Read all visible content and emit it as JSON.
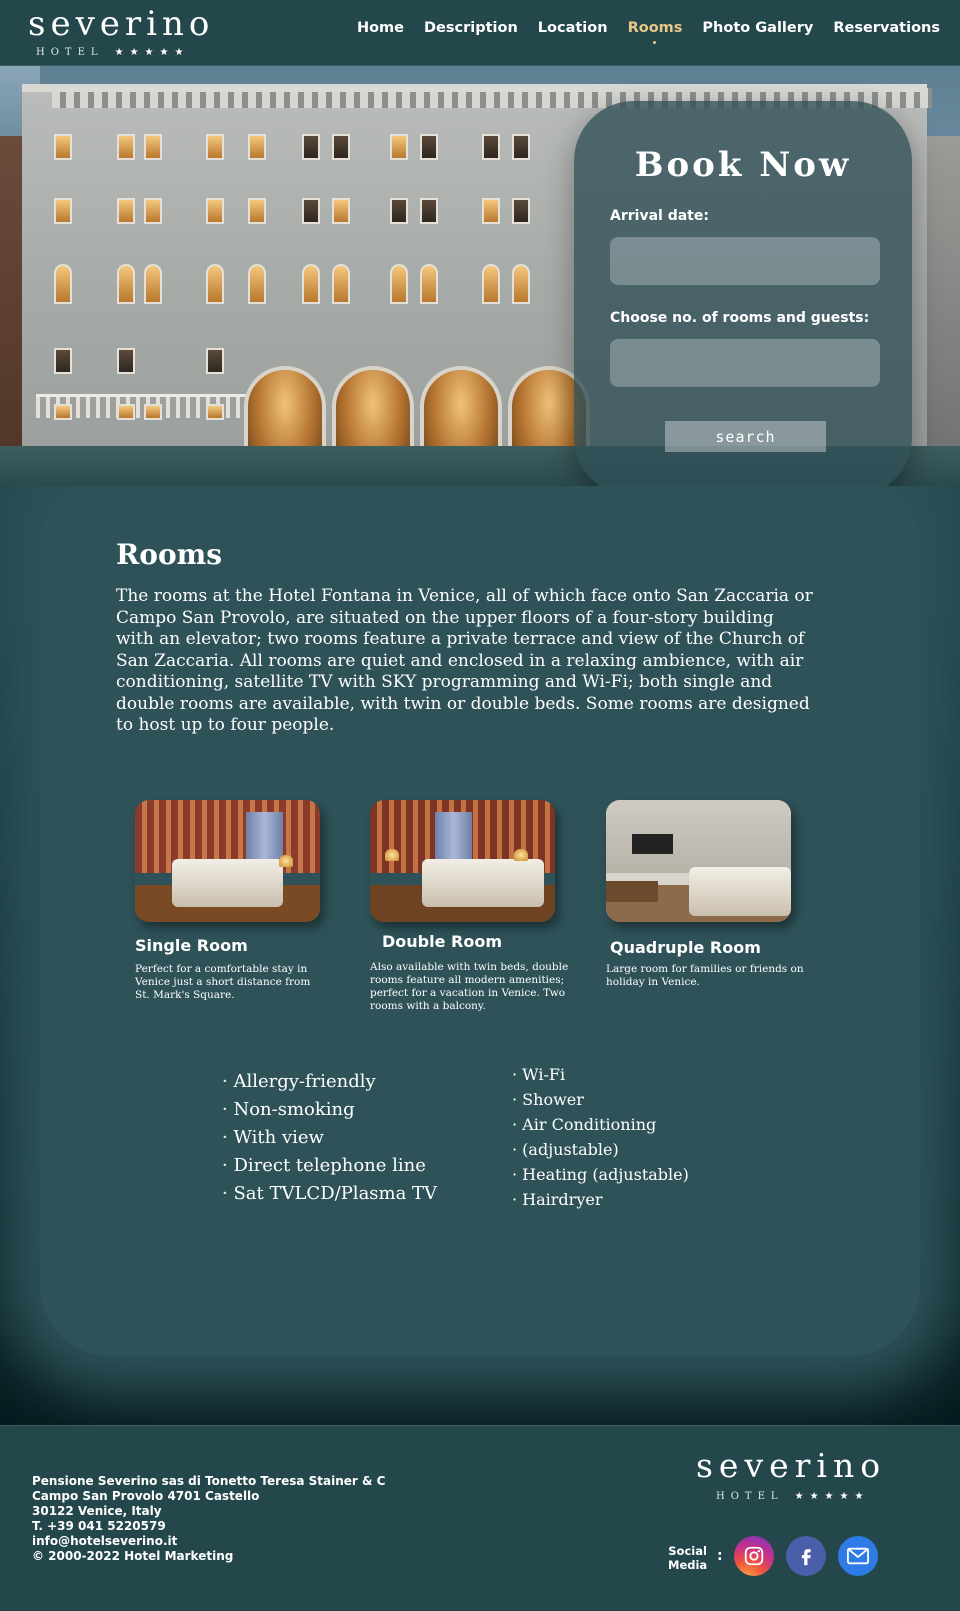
{
  "brand": {
    "name": "severino",
    "sub": "HOTEL",
    "stars": "★★★★★"
  },
  "nav": {
    "items": [
      {
        "label": "Home"
      },
      {
        "label": "Description"
      },
      {
        "label": "Location"
      },
      {
        "label": "Rooms",
        "active": true
      },
      {
        "label": "Photo Gallery"
      },
      {
        "label": "Reservations"
      }
    ]
  },
  "booking": {
    "title": "Book Now",
    "arrival_label": "Arrival date:",
    "arrival_value": "",
    "guests_label": "Choose no. of rooms and guests:",
    "guests_value": "",
    "search_label": "search"
  },
  "rooms": {
    "title": "Rooms",
    "intro": "The rooms at the Hotel Fontana in Venice, all of which face onto San Zaccaria or Campo San Provolo, are situated on the upper floors of a four-story building with an elevator; two rooms feature a private terrace and view of the Church of San Zaccaria. All rooms are quiet and enclosed in a relaxing ambience, with air conditioning, satellite TV with SKY programming and Wi-Fi; both single and double rooms are available, with twin or double beds. Some rooms are designed to host up to four people.",
    "cards": [
      {
        "name": "Single Room",
        "desc": "Perfect for a comfortable stay in Venice just a short distance from St. Mark's Square."
      },
      {
        "name": "Double Room",
        "desc": "Also available with twin beds, double rooms feature all modern amenities; perfect for a vacation in Venice. Two rooms with a balcony."
      },
      {
        "name": "Quadruple Room",
        "desc": "Large room for families or friends on holiday in Venice."
      }
    ],
    "features_left": [
      "Allergy-friendly",
      "Non-smoking",
      "With view",
      "Direct telephone line",
      "Sat TVLCD/Plasma TV"
    ],
    "features_right": [
      "Wi-Fi",
      "Shower",
      "Air Conditioning",
      "(adjustable)",
      "Heating (adjustable)",
      "Hairdryer"
    ]
  },
  "footer": {
    "lines": [
      "Pensione Severino sas di Tonetto Teresa Stainer & C",
      "Campo San Provolo 4701 Castello",
      "30122 Venice, Italy",
      "T. +39 041 5220579",
      "info@hotelseverino.it",
      "© 2000-2022 Hotel Marketing"
    ],
    "social_label_1": "Social",
    "social_label_2": "Media",
    "social_colon": ":"
  },
  "colors": {
    "header_bg": "#24474c",
    "accent": "#e8c886",
    "content_bg": "#2e5258",
    "instagram": "#c3308f",
    "facebook": "#4a5fa7",
    "mail": "#2f7be6"
  }
}
